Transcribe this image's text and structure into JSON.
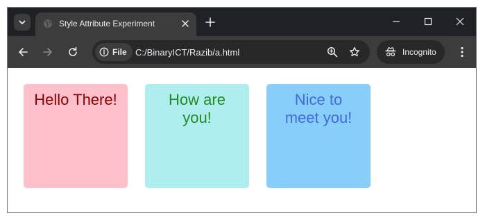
{
  "browser": {
    "tab": {
      "title": "Style Attribute Experiment"
    },
    "address_bar": {
      "site_chip_label": "File",
      "url": "C:/BinaryICT/Razib/a.html"
    },
    "profile": {
      "label": "Incognito"
    },
    "icons": {
      "tab_search": "chevron-down-icon",
      "favicon": "globe-icon",
      "tab_close": "close-icon",
      "new_tab": "plus-icon",
      "minimize": "minimize-icon",
      "maximize": "maximize-icon",
      "close_window": "close-icon",
      "back": "arrow-left-icon",
      "forward": "arrow-right-icon",
      "reload": "reload-icon",
      "site_info": "info-icon",
      "zoom": "zoom-icon",
      "bookmark": "star-icon",
      "incognito": "incognito-icon",
      "menu": "kebab-menu-icon"
    },
    "colors": {
      "tabstrip_bg": "#202124",
      "toolbar_bg": "#3c3c3c",
      "omnibox_bg": "#282828",
      "text": "#e8eaed"
    }
  },
  "page": {
    "boxes": [
      {
        "text": "Hello There!",
        "background": "#ffc0cb",
        "color": "#8b0000"
      },
      {
        "text": "How are you!",
        "background": "#afeeee",
        "color": "#228b22"
      },
      {
        "text": "Nice to meet you!",
        "background": "#87cefa",
        "color": "#4169e1"
      }
    ]
  }
}
